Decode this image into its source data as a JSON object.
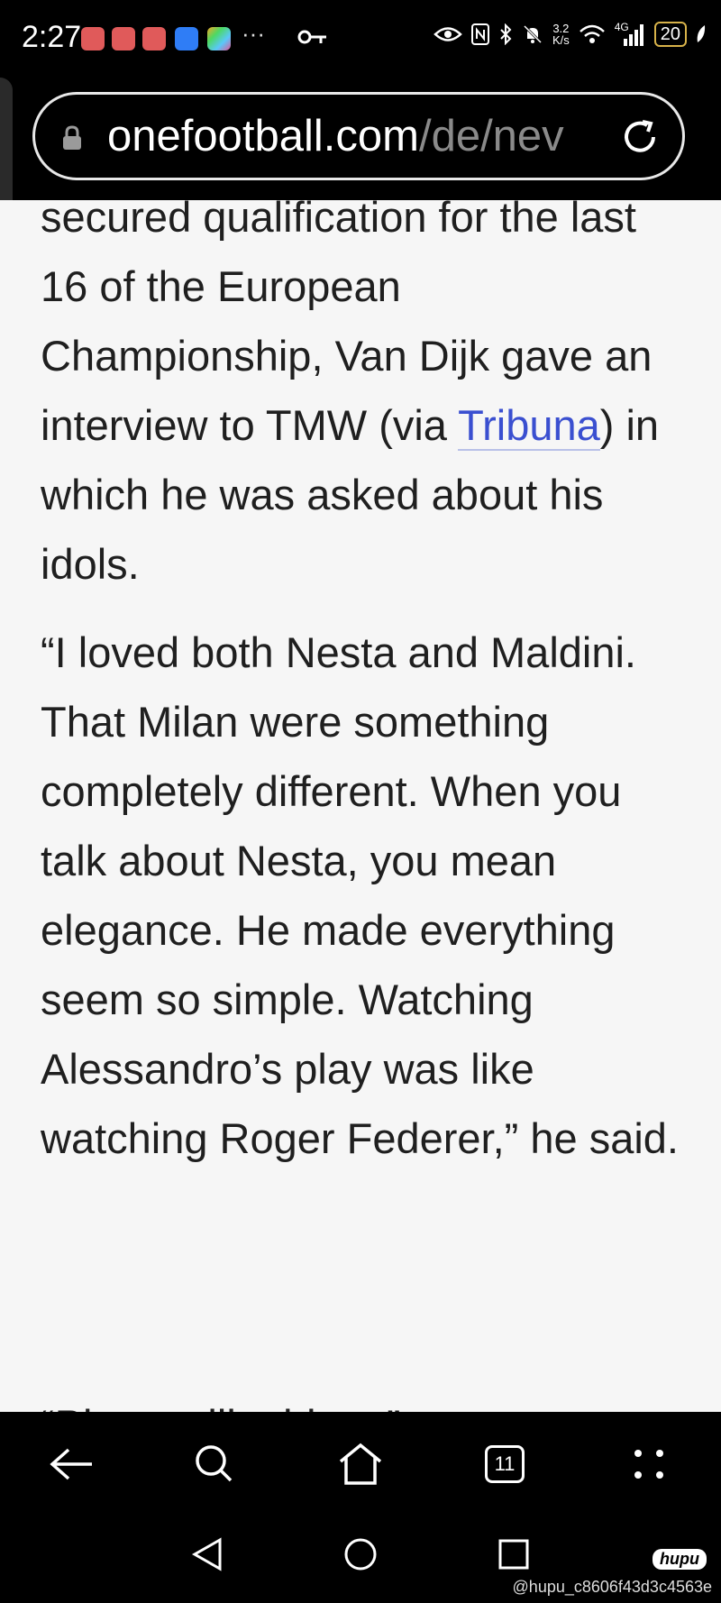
{
  "status_bar": {
    "time": "2:27",
    "more": "···",
    "net_speed_value": "3.2",
    "net_speed_unit": "K/s",
    "network_type": "4G",
    "battery": "20"
  },
  "browser": {
    "url_host": "onefootball.com",
    "url_path": "/de/nev"
  },
  "article": {
    "paragraph1_before_link": "secured qualification for the last 16 of the European Championship, Van Dijk gave an interview to TMW (via ",
    "paragraph1_link": "Tribuna",
    "paragraph1_after_link": ") in which he was asked about his idols.",
    "paragraph2": "“I loved both Nesta and Maldini. That Milan were something completely different. When you talk about Nesta, you mean elegance. He made everything seem so simple. Watching Alessandro’s play was like watching Roger Federer,” he said.",
    "paragraph3_partial": "“Players like him...”"
  },
  "bottom_nav": {
    "tab_count": "11"
  },
  "watermark": {
    "brand": "hupu",
    "handle": "@hupu_c8606f43d3c4563e"
  }
}
